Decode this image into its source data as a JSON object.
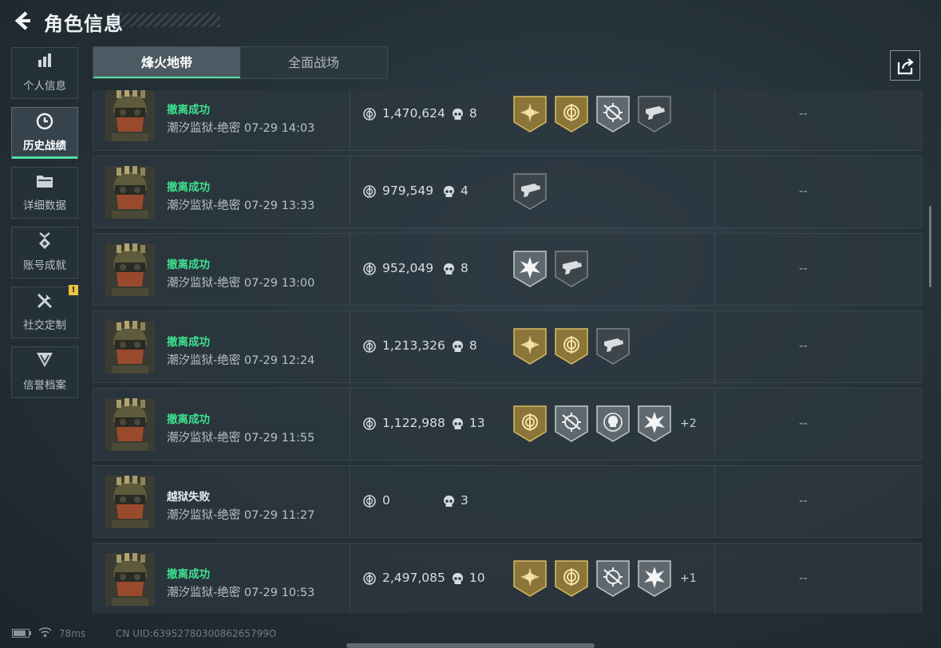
{
  "header": {
    "title": "角色信息",
    "back_icon": "back-chevron-icon"
  },
  "sidebar": {
    "items": [
      {
        "label": "个人信息",
        "icon": "bar-chart-icon",
        "active": false
      },
      {
        "label": "历史战绩",
        "icon": "history-clock-icon",
        "active": true
      },
      {
        "label": "详细数据",
        "icon": "folder-icon",
        "active": false
      },
      {
        "label": "账号成就",
        "icon": "medal-icon",
        "active": false
      },
      {
        "label": "社交定制",
        "icon": "tools-icon",
        "active": false,
        "badge": "!"
      },
      {
        "label": "信誉档案",
        "icon": "shield-icon",
        "active": false
      }
    ]
  },
  "tabs": [
    {
      "label": "烽火地带",
      "active": true
    },
    {
      "label": "全面战场",
      "active": false
    }
  ],
  "matches": [
    {
      "status": "撤离成功",
      "success": true,
      "map": "潮汐监狱-绝密",
      "time": "07-29 14:03",
      "value": "1,470,624",
      "kills": "8",
      "badges": [
        "gold-sun-badge",
        "gold-emblem-badge",
        "silver-crosshair-badge",
        "dark-gun-badge"
      ],
      "more": "",
      "score": "--"
    },
    {
      "status": "撤离成功",
      "success": true,
      "map": "潮汐监狱-绝密",
      "time": "07-29 13:33",
      "value": "979,549",
      "kills": "4",
      "badges": [
        "dark-gun-badge"
      ],
      "more": "",
      "score": "--"
    },
    {
      "status": "撤离成功",
      "success": true,
      "map": "潮汐监狱-绝密",
      "time": "07-29 13:00",
      "value": "952,049",
      "kills": "8",
      "badges": [
        "silver-burst-badge",
        "dark-gun-badge"
      ],
      "more": "",
      "score": "--"
    },
    {
      "status": "撤离成功",
      "success": true,
      "map": "潮汐监狱-绝密",
      "time": "07-29 12:24",
      "value": "1,213,326",
      "kills": "8",
      "badges": [
        "gold-sun-badge",
        "gold-emblem-badge",
        "dark-gun-badge"
      ],
      "more": "",
      "score": "--"
    },
    {
      "status": "撤离成功",
      "success": true,
      "map": "潮汐监狱-绝密",
      "time": "07-29 11:55",
      "value": "1,122,988",
      "kills": "13",
      "badges": [
        "gold-emblem-badge",
        "silver-crosshair-badge",
        "silver-skull-badge",
        "silver-burst-badge"
      ],
      "more": "+2",
      "score": "--"
    },
    {
      "status": "越狱失败",
      "success": false,
      "map": "潮汐监狱-绝密",
      "time": "07-29 11:27",
      "value": "0",
      "kills": "3",
      "badges": [],
      "more": "",
      "score": "--"
    },
    {
      "status": "撤离成功",
      "success": true,
      "map": "潮汐监狱-绝密",
      "time": "07-29 10:53",
      "value": "2,497,085",
      "kills": "10",
      "badges": [
        "gold-sun-badge",
        "gold-emblem-badge",
        "silver-crosshair-badge",
        "silver-burst-badge"
      ],
      "more": "+1",
      "score": "--"
    }
  ],
  "footer": {
    "ping": "78ms",
    "uid": "CN UID:6395278030086265799O"
  },
  "colors": {
    "accent": "#4fe0a0",
    "success": "#3ee28f",
    "gold": "#c9a54f",
    "silver": "#b8c0c5",
    "warning": "#e9c43b"
  }
}
